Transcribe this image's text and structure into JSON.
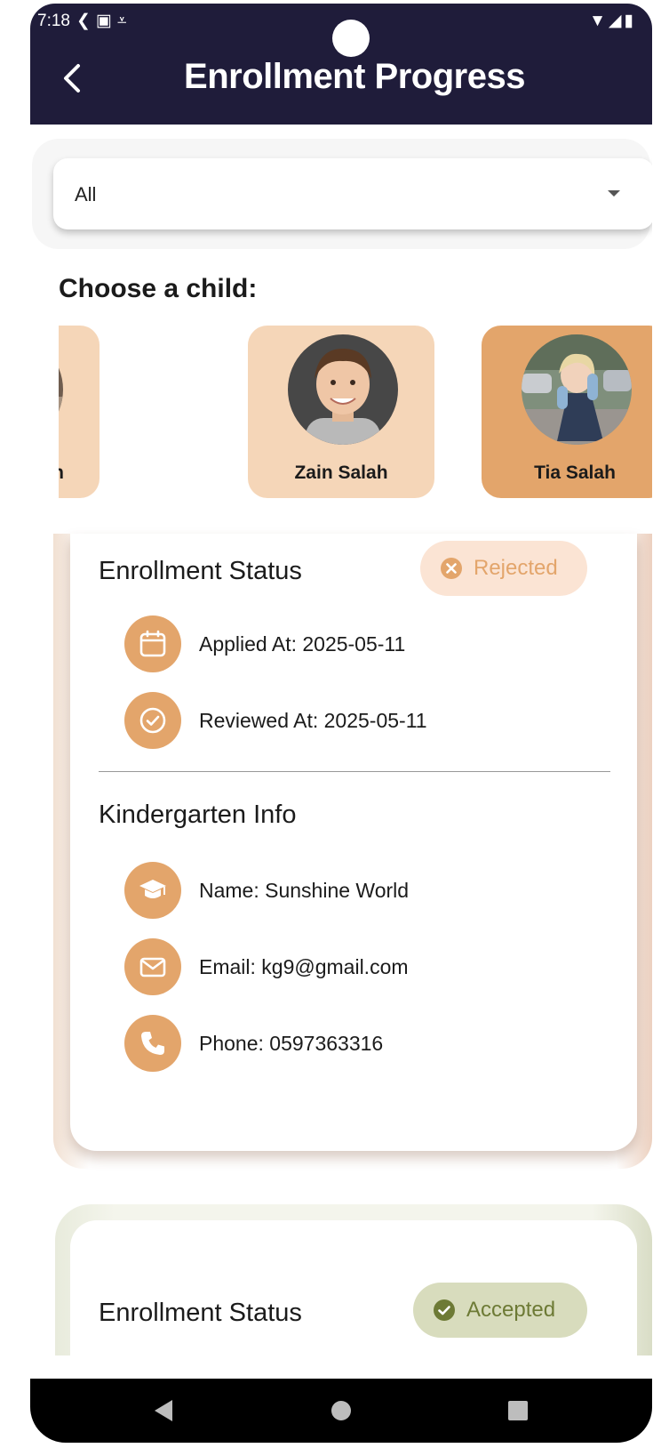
{
  "status_bar": {
    "time": "7:18",
    "left_icons": [
      "phone-link-icon",
      "a-box-icon",
      "download-done-icon"
    ],
    "right_icons": [
      "wifi-icon",
      "signal-icon",
      "battery-icon"
    ]
  },
  "app_bar": {
    "title": "Enrollment Progress",
    "back_icon": "chevron-left-icon"
  },
  "filter": {
    "selected": "All"
  },
  "children_section": {
    "label": "Choose a child:",
    "children": [
      {
        "name": "Nuri Salah",
        "visible_name": "uri Salah",
        "selected": false
      },
      {
        "name": "Zain Salah",
        "visible_name": "Zain Salah",
        "selected": false
      },
      {
        "name": "Tia Salah",
        "visible_name": "Tia Salah",
        "selected": true
      }
    ]
  },
  "enrollment_1": {
    "status_title": "Enrollment Status",
    "status": "Rejected",
    "status_icon": "x-circle-icon",
    "applied": "Applied At: 2025-05-11",
    "reviewed": "Reviewed At: 2025-05-11",
    "kg_title": "Kindergarten Info",
    "kg_name": "Name: Sunshine World",
    "kg_email": "Email: kg9@gmail.com",
    "kg_phone": "Phone: 0597363316"
  },
  "enrollment_2": {
    "status_title": "Enrollment Status",
    "status": "Accepted",
    "status_icon": "check-circle-icon"
  },
  "colors": {
    "app_bar": "#1f1c3a",
    "accent": "#e3a56b",
    "child_card": "#f5d6b8",
    "rejected_chip_bg": "#fbe4d4",
    "accepted_chip_bg": "#d8dcbd",
    "accepted_text": "#6d7a35"
  }
}
